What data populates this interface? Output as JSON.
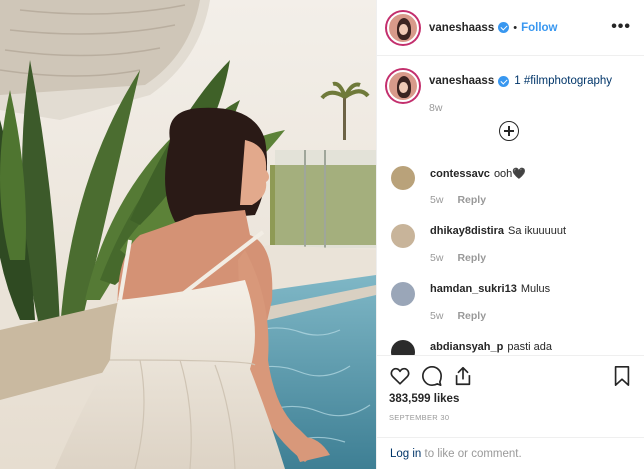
{
  "post": {
    "username": "vaneshaass",
    "follow_label": "Follow",
    "separator": "•",
    "caption_emoji": "1",
    "caption_tag": "#filmphotography",
    "caption_time": "8w",
    "likes": "383,599 likes",
    "date": "SEPTEMBER 30"
  },
  "comments": [
    {
      "user": "contessavc",
      "text": "ooh🖤",
      "time": "5w",
      "reply": "Reply",
      "avatar_color": "#b9a27a"
    },
    {
      "user": "dhikay8distira",
      "text": "Sa ikuuuuut",
      "time": "5w",
      "reply": "Reply",
      "avatar_color": "#c8b49a"
    },
    {
      "user": "hamdan_sukri13",
      "text": "Mulus",
      "time": "5w",
      "reply": "Reply",
      "avatar_color": "#9aa6b8"
    },
    {
      "user": "abdiansyah_p",
      "text": "pasti ada",
      "time": "",
      "reply": "",
      "avatar_color": "#2b2b2b"
    }
  ],
  "footer": {
    "login": "Log in",
    "rest": " to like or comment."
  },
  "colors": {
    "link_blue": "#3897f0",
    "text_dark": "#262626",
    "muted": "#999999",
    "story_ring": "#c32f6d"
  }
}
